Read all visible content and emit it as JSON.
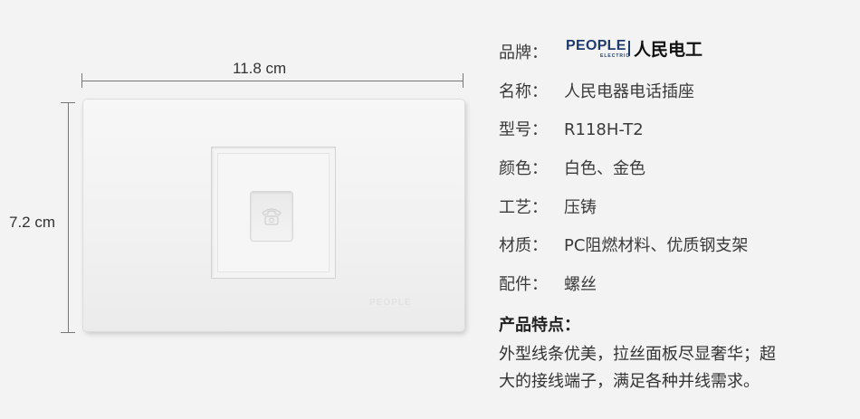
{
  "dimensions": {
    "width": "11.8 cm",
    "height": "7.2 cm"
  },
  "product": {
    "plate_brand": "PEOPLE",
    "jack_icon": "telephone-icon"
  },
  "brand": {
    "label": "品牌：",
    "logo_en": "PEOPLE",
    "logo_sub": "ELECTRIC",
    "logo_cn": "人民电工"
  },
  "specs": [
    {
      "label": "名称：",
      "value": "人民电器电话插座"
    },
    {
      "label": "型号：",
      "value": "R118H-T2"
    },
    {
      "label": "颜色：",
      "value": "白色、金色"
    },
    {
      "label": "工艺：",
      "value": "压铸"
    },
    {
      "label": "材质：",
      "value": "PC阻燃材料、优质钢支架"
    },
    {
      "label": "配件：",
      "value": "螺丝"
    }
  ],
  "features": {
    "title": "产品特点：",
    "line1": "外型线条优美，拉丝面板尽显奢华；超",
    "line2": "大的接线端子，满足各种并线需求。"
  }
}
